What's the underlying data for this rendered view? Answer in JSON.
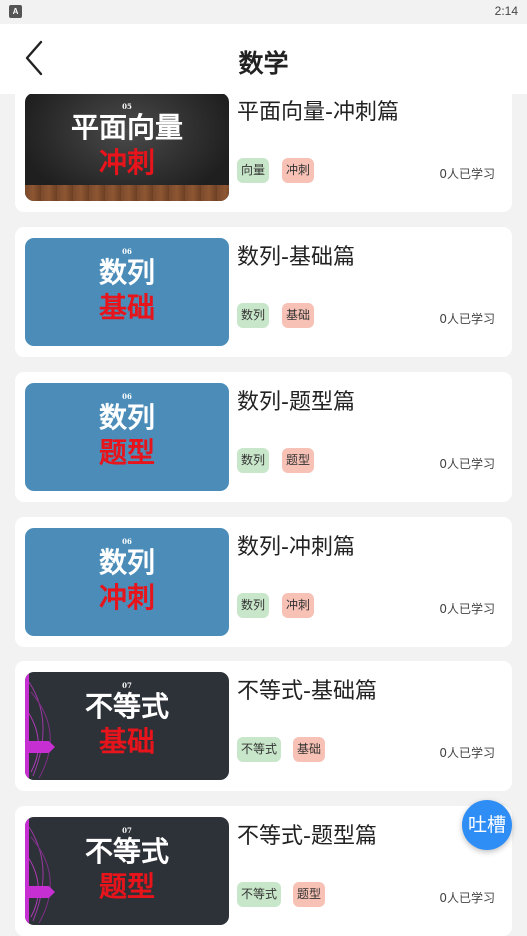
{
  "status_bar": {
    "icon_label": "A",
    "time": "2:14"
  },
  "header": {
    "title": "数学",
    "back_icon": "chevron-left-icon"
  },
  "courses": [
    {
      "number": "05",
      "line1": "平面向量",
      "line2": "冲刺",
      "title": "平面向量-冲刺篇",
      "tag1": "向量",
      "tag2": "冲刺",
      "learners": "0人已学习",
      "style": "dark"
    },
    {
      "number": "06",
      "line1": "数列",
      "line2": "基础",
      "title": "数列-基础篇",
      "tag1": "数列",
      "tag2": "基础",
      "learners": "0人已学习",
      "style": "blue"
    },
    {
      "number": "06",
      "line1": "数列",
      "line2": "题型",
      "title": "数列-题型篇",
      "tag1": "数列",
      "tag2": "题型",
      "learners": "0人已学习",
      "style": "blue"
    },
    {
      "number": "06",
      "line1": "数列",
      "line2": "冲刺",
      "title": "数列-冲刺篇",
      "tag1": "数列",
      "tag2": "冲刺",
      "learners": "0人已学习",
      "style": "blue"
    },
    {
      "number": "07",
      "line1": "不等式",
      "line2": "基础",
      "title": "不等式-基础篇",
      "tag1": "不等式",
      "tag2": "基础",
      "learners": "0人已学习",
      "style": "navy"
    },
    {
      "number": "07",
      "line1": "不等式",
      "line2": "题型",
      "title": "不等式-题型篇",
      "tag1": "不等式",
      "tag2": "题型",
      "learners": "0人已学习",
      "style": "navy"
    }
  ],
  "feedback_button": {
    "label": "吐槽"
  },
  "colors": {
    "accent_blue": "#2f8ef5",
    "tag_green": "#c8e6c9",
    "tag_red": "#f7c1b5",
    "thumb_red_text": "#e8141b"
  }
}
